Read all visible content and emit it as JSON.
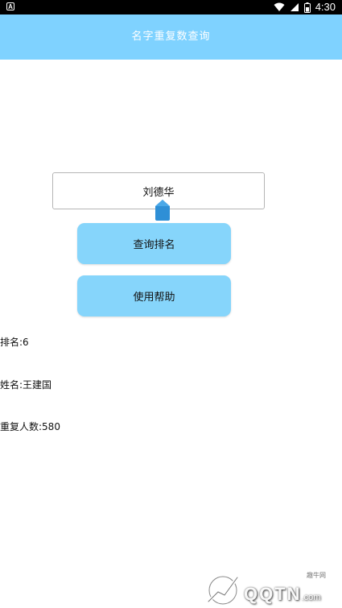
{
  "status_bar": {
    "left_icon": "A",
    "time": "4:30",
    "icons": [
      "wifi-icon",
      "signal-icon",
      "battery-icon"
    ]
  },
  "header": {
    "title": "名字重复数查询"
  },
  "form": {
    "name_value": "刘德华"
  },
  "buttons": {
    "query_label": "查询排名",
    "help_label": "使用帮助"
  },
  "results": {
    "rank": "排名:6",
    "name": "姓名:王建国",
    "count": "重复人数:580"
  },
  "watermark": {
    "small_text": "趣牛网",
    "text": "QQTN",
    "suffix": ".com"
  },
  "colors": {
    "accent": "#7fd2ff",
    "button": "#86d5fb",
    "cursor_handle": "#2e8fd6"
  }
}
